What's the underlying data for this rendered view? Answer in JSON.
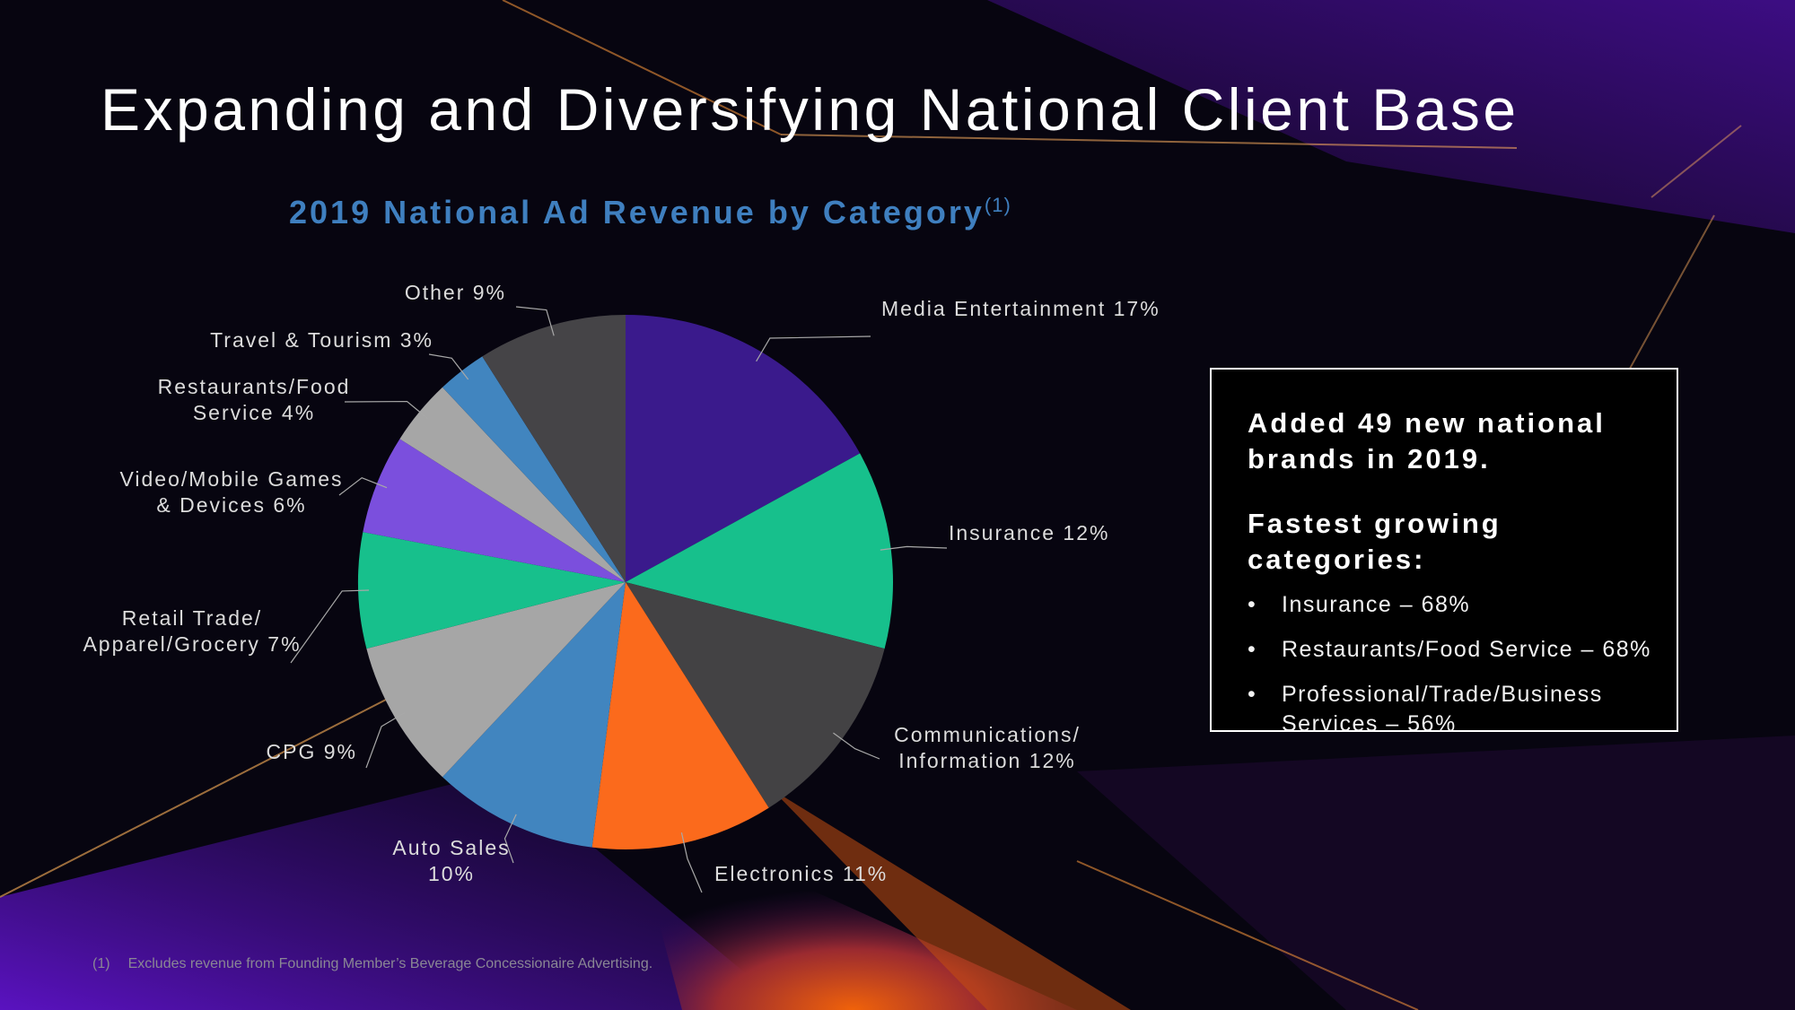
{
  "slide": {
    "title": "Expanding and Diversifying National Client Base",
    "footnote_number": "(1)",
    "footnote_text": "Excludes revenue from Founding Member’s Beverage Concessionaire Advertising."
  },
  "callout": {
    "headline": "Added 49 new national brands in 2019.",
    "subhead": "Fastest growing categories:",
    "bullet_symbol": "•",
    "items": [
      "Insurance – 68%",
      "Restaurants/Food Service – 68%",
      "Professional/Trade/Business Services – 56%"
    ]
  },
  "chart_data": {
    "type": "pie",
    "title": "2019 National Ad Revenue by Category",
    "title_superscript": "(1)",
    "slices": [
      {
        "label": [
          "Media Entertainment 17%"
        ],
        "value": 17,
        "color": "#3a1a8c"
      },
      {
        "label": [
          "Insurance 12%"
        ],
        "value": 12,
        "color": "#17c08c"
      },
      {
        "label": [
          "Communications/",
          "Information 12%"
        ],
        "value": 12,
        "color": "#434244"
      },
      {
        "label": [
          "Electronics 11%"
        ],
        "value": 11,
        "color": "#fb6a1c"
      },
      {
        "label": [
          "Auto Sales",
          "10%"
        ],
        "value": 10,
        "color": "#4185bf"
      },
      {
        "label": [
          "CPG 9%"
        ],
        "value": 9,
        "color": "#a6a6a6"
      },
      {
        "label": [
          "Retail Trade/",
          "Apparel/Grocery 7%"
        ],
        "value": 7,
        "color": "#17c08c"
      },
      {
        "label": [
          "Video/Mobile Games",
          "& Devices 6%"
        ],
        "value": 6,
        "color": "#7b4fdd"
      },
      {
        "label": [
          "Restaurants/Food",
          "Service 4%"
        ],
        "value": 4,
        "color": "#a6a6a6"
      },
      {
        "label": [
          "Travel & Tourism 3%"
        ],
        "value": 3,
        "color": "#4185bf"
      },
      {
        "label": [
          "Other 9%"
        ],
        "value": 9,
        "color": "#454447"
      }
    ]
  }
}
